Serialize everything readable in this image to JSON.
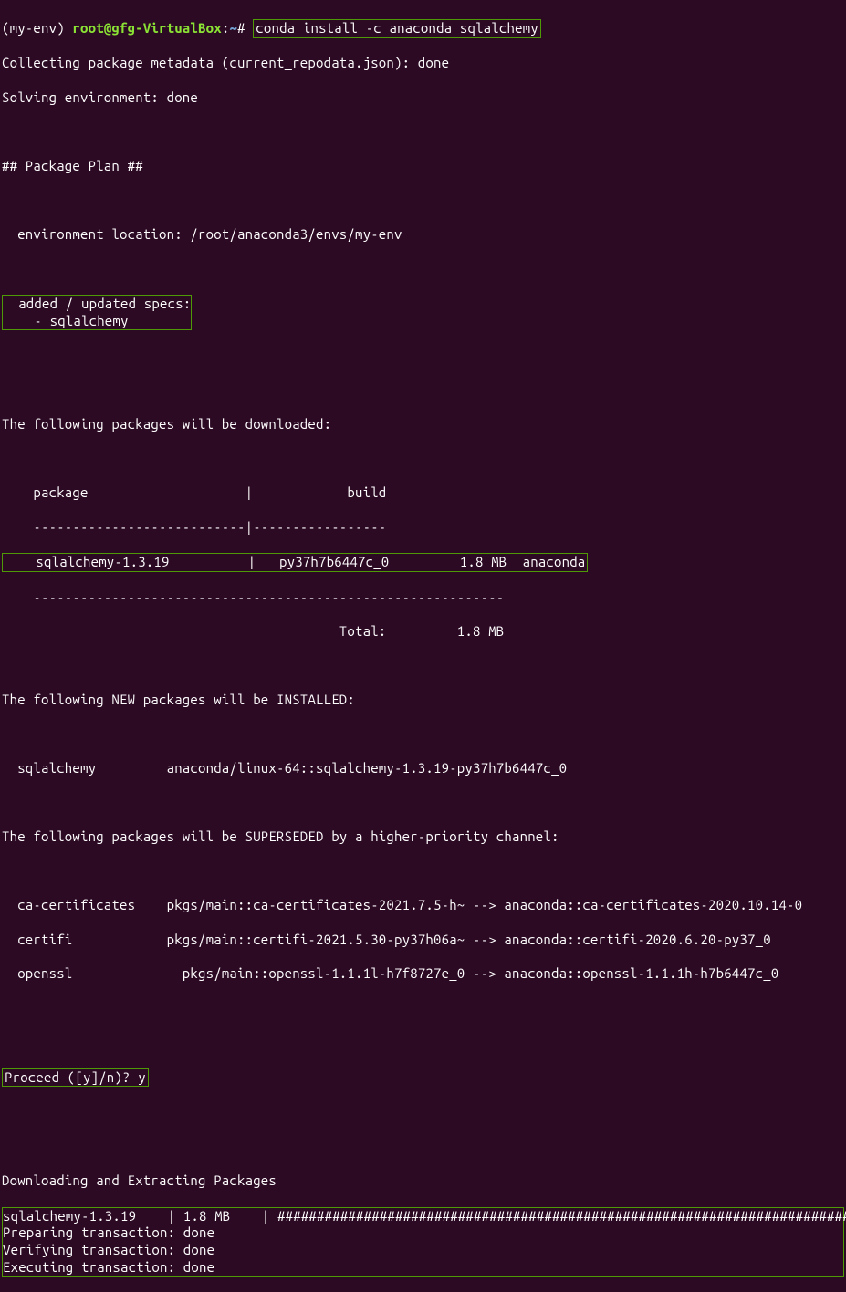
{
  "prompt": {
    "env": "(my-env)",
    "userhost": "root@gfg-VirtualBox",
    "path": "~",
    "sign": "#",
    "command": "conda install -c anaconda sqlalchemy"
  },
  "output": {
    "collecting": "Collecting package metadata (current_repodata.json): done",
    "solving": "Solving environment: done",
    "plan_header": "## Package Plan ##",
    "env_location": "  environment location: /root/anaconda3/envs/my-env",
    "added_specs_l1": "  added / updated specs:",
    "added_specs_l2": "    - sqlalchemy",
    "downloaded_header": "The following packages will be downloaded:",
    "table_header": "    package                    |            build",
    "table_sep1": "    ---------------------------|-----------------",
    "table_row": "    sqlalchemy-1.3.19          |   py37h7b6447c_0         1.8 MB  anaconda",
    "table_sep2": "    ------------------------------------------------------------",
    "table_total": "                                           Total:         1.8 MB",
    "new_header": "The following NEW packages will be INSTALLED:",
    "new_pkg": "  sqlalchemy         anaconda/linux-64::sqlalchemy-1.3.19-py37h7b6447c_0",
    "superseded_header": "The following packages will be SUPERSEDED by a higher-priority channel:",
    "superseded_1": "  ca-certificates    pkgs/main::ca-certificates-2021.7.5-h~ --> anaconda::ca-certificates-2020.10.14-0",
    "superseded_2": "  certifi            pkgs/main::certifi-2021.5.30-py37h06a~ --> anaconda::certifi-2020.6.20-py37_0",
    "superseded_3": "  openssl              pkgs/main::openssl-1.1.1l-h7f8727e_0 --> anaconda::openssl-1.1.1h-h7b6447c_0",
    "proceed": "Proceed ([y]/n)? y",
    "dl_header": "Downloading and Extracting Packages",
    "dl_row": "sqlalchemy-1.3.19    | 1.8 MB    | ",
    "dl_bar": "##########################################################################",
    "tx1": "Preparing transaction: done",
    "tx2": "Verifying transaction: done",
    "tx3": "Executing transaction: done"
  }
}
